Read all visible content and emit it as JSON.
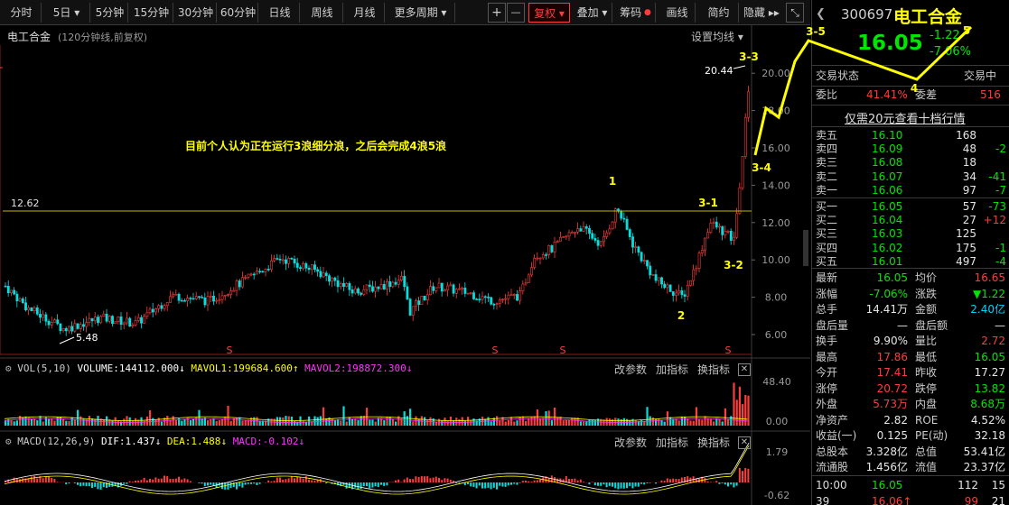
{
  "toolbar": {
    "periods": [
      "分时",
      "5日",
      "5分钟",
      "15分钟",
      "30分钟",
      "60分钟",
      "日线",
      "周线",
      "月线",
      "更多周期"
    ],
    "plus": "+",
    "minus": "—",
    "fq": "复权",
    "overlay": "叠加",
    "chips": "筹码",
    "draw": "画线",
    "simple": "简约",
    "hide": "隐藏"
  },
  "chart": {
    "name": "电工合金",
    "subtitle": "(120分钟线,前复权)",
    "ma_settings": "设置均线",
    "hline_label": "12.62",
    "high_label": "20.44",
    "low_label": "5.48",
    "annotation": "目前个人认为正在运行3浪细分浪，之后会完成4浪5浪",
    "wave_labels": [
      "1",
      "2",
      "3-1",
      "3-2",
      "3-3",
      "3-4",
      "3-5",
      "4",
      "5"
    ],
    "y_ticks": [
      "20.00",
      "18.00",
      "16.00",
      "14.00",
      "12.00",
      "10.00",
      "8.00",
      "6.00"
    ],
    "s_marker": "S",
    "colors": {
      "up": "#ff3c3c",
      "down": "#00e0e0",
      "annotation": "#ffff00",
      "hline": "#c8b400"
    }
  },
  "vol": {
    "label": "VOL(5,10)",
    "volume": "VOLUME:144112.000",
    "mavol1": "MAVOL1:199684.600",
    "mavol2": "MAVOL2:198872.300",
    "y_max": "48.40",
    "y_min": "0.00",
    "btn_params": "改参数",
    "btn_add": "加指标",
    "btn_switch": "换指标"
  },
  "macd": {
    "label": "MACD(12,26,9)",
    "dif": "DIF:1.437",
    "dea": "DEA:1.488",
    "macd": "MACD:-0.102",
    "y_max": "1.79",
    "y_min": "-0.62",
    "btn_params": "改参数",
    "btn_add": "加指标",
    "btn_switch": "换指标"
  },
  "stock": {
    "code": "300697",
    "name": "电工合金",
    "price": "16.05",
    "change": "-1.22",
    "change_pct": "-7.06%",
    "trade_status_label": "交易状态",
    "trade_status": "交易中",
    "weibi_label": "委比",
    "weibi": "41.41%",
    "weicha_label": "委差",
    "weicha": "516",
    "level2_link": "仅需20元查看十档行情"
  },
  "orderbook": {
    "asks": [
      {
        "label": "卖五",
        "price": "16.10",
        "vol": "168",
        "chg": ""
      },
      {
        "label": "卖四",
        "price": "16.09",
        "vol": "48",
        "chg": "-2"
      },
      {
        "label": "卖三",
        "price": "16.08",
        "vol": "18",
        "chg": ""
      },
      {
        "label": "卖二",
        "price": "16.07",
        "vol": "34",
        "chg": "-41"
      },
      {
        "label": "卖一",
        "price": "16.06",
        "vol": "97",
        "chg": "-7"
      }
    ],
    "bids": [
      {
        "label": "买一",
        "price": "16.05",
        "vol": "57",
        "chg": "-73"
      },
      {
        "label": "买二",
        "price": "16.04",
        "vol": "27",
        "chg": "+12"
      },
      {
        "label": "买三",
        "price": "16.03",
        "vol": "125",
        "chg": ""
      },
      {
        "label": "买四",
        "price": "16.02",
        "vol": "175",
        "chg": "-1"
      },
      {
        "label": "买五",
        "price": "16.01",
        "vol": "497",
        "chg": "-4"
      }
    ]
  },
  "stats": [
    {
      "l1": "最新",
      "v1": "16.05",
      "c1": "green",
      "l2": "均价",
      "v2": "16.65",
      "c2": "red"
    },
    {
      "l1": "涨幅",
      "v1": "-7.06%",
      "c1": "green",
      "l2": "涨跌",
      "v2": "▼1.22",
      "c2": "green"
    },
    {
      "l1": "总手",
      "v1": "14.41万",
      "c1": "white",
      "l2": "金额",
      "v2": "2.40亿",
      "c2": "cyan"
    },
    {
      "l1": "盘后量",
      "v1": "—",
      "c1": "white",
      "l2": "盘后额",
      "v2": "—",
      "c2": "white"
    },
    {
      "l1": "换手",
      "v1": "9.90%",
      "c1": "white",
      "l2": "量比",
      "v2": "2.72",
      "c2": "red"
    },
    {
      "l1": "最高",
      "v1": "17.86",
      "c1": "red",
      "l2": "最低",
      "v2": "16.05",
      "c2": "green"
    },
    {
      "l1": "今开",
      "v1": "17.41",
      "c1": "red",
      "l2": "昨收",
      "v2": "17.27",
      "c2": "white"
    },
    {
      "l1": "涨停",
      "v1": "20.72",
      "c1": "red",
      "l2": "跌停",
      "v2": "13.82",
      "c2": "green"
    },
    {
      "l1": "外盘",
      "v1": "5.73万",
      "c1": "red",
      "l2": "内盘",
      "v2": "8.68万",
      "c2": "green"
    },
    {
      "l1": "净资产",
      "v1": "2.82",
      "c1": "white",
      "l2": "ROE",
      "v2": "4.52%",
      "c2": "white"
    },
    {
      "l1": "收益(一)",
      "v1": "0.125",
      "c1": "white",
      "l2": "PE(动)",
      "v2": "32.18",
      "c2": "white"
    },
    {
      "l1": "总股本",
      "v1": "3.328亿",
      "c1": "white",
      "l2": "总值",
      "v2": "53.41亿",
      "c2": "white"
    },
    {
      "l1": "流通股",
      "v1": "1.456亿",
      "c1": "white",
      "l2": "流值",
      "v2": "23.37亿",
      "c2": "white"
    }
  ],
  "ticks": [
    {
      "time": "10:00",
      "price": "16.05",
      "vol": "112",
      "n": "15"
    },
    {
      "time": "39",
      "price": "16.06↑",
      "vol": "99",
      "n": "21"
    }
  ]
}
